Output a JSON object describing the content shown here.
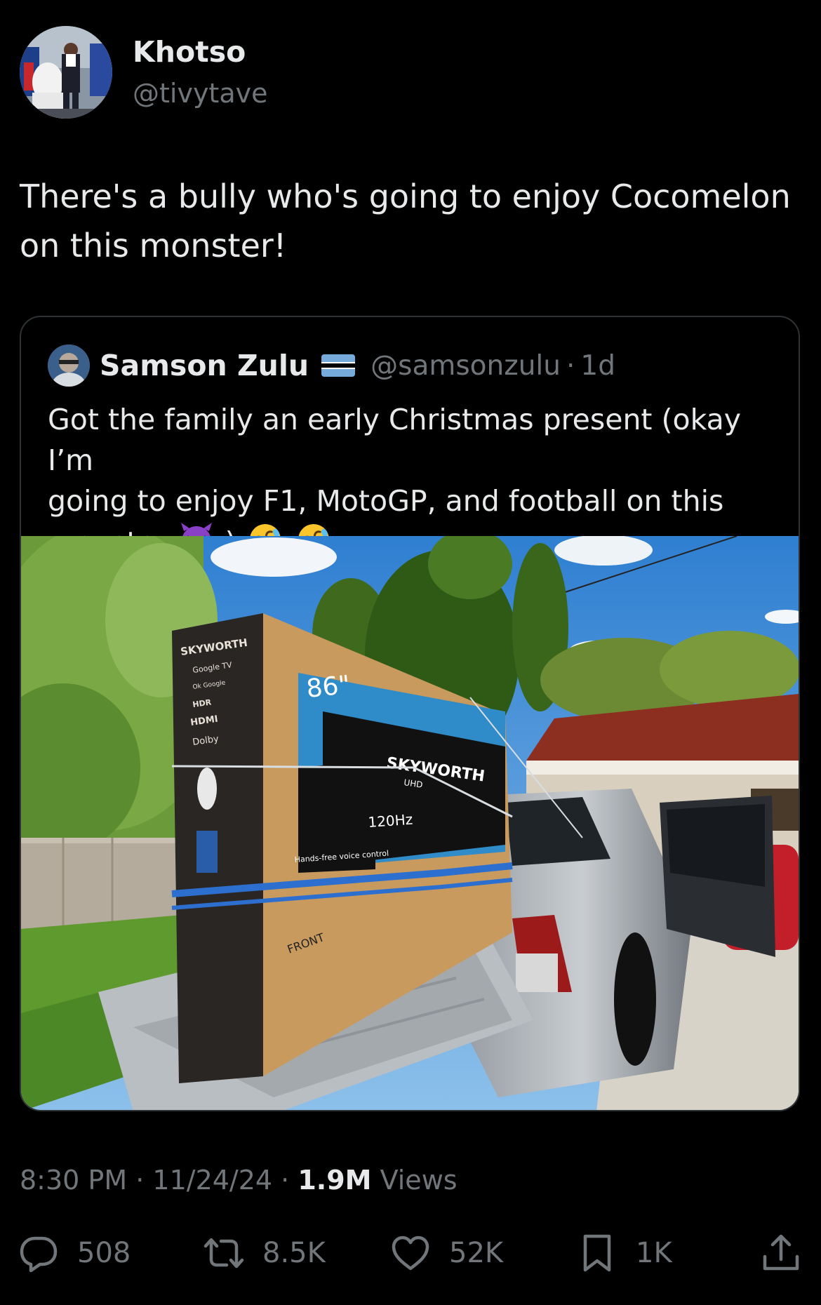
{
  "author": {
    "display_name": "Khotso",
    "handle": "@tivytave",
    "avatar_icon": "profile-photo"
  },
  "tweet": {
    "text_line1": "There's a bully who's going to enjoy Cocomelon",
    "text_line2": "on this monster!"
  },
  "quoted_tweet": {
    "display_name": "Samson Zulu",
    "flag_icon": "botswana-flag",
    "handle": "@samsonzulu",
    "separator": "·",
    "time": "1d",
    "text_line1": "Got the family an early Christmas present (okay I’m",
    "text_line2": "going to enjoy F1, MotoGP, and football on this",
    "text_line3_start": "monster",
    "text_line3_end": ")",
    "emojis": [
      "smiling-face-with-horns",
      "rolling-on-floor-laughing",
      "rolling-on-floor-laughing"
    ],
    "image": {
      "brand": "SKYWORTH",
      "size": "86\"",
      "refresh": "120Hz",
      "side_label": "FRONT",
      "left_panel": [
        "SKYWORTH",
        "Google TV",
        "Ok Google",
        "HDR",
        "HDMI",
        "Dolby"
      ],
      "uhd_label": "UHD",
      "voice_label": "Hands-free voice control"
    }
  },
  "meta": {
    "time": "8:30 PM",
    "sep1": "·",
    "date": "11/24/24",
    "sep2": "·",
    "views_count": "1.9M",
    "views_label": "Views"
  },
  "actions": {
    "replies": "508",
    "reposts": "8.5K",
    "likes": "52K",
    "bookmarks": "1K"
  },
  "colors": {
    "background": "#000000",
    "text_primary": "#e7e9ea",
    "text_secondary": "#71767b",
    "border": "#2f3336"
  }
}
